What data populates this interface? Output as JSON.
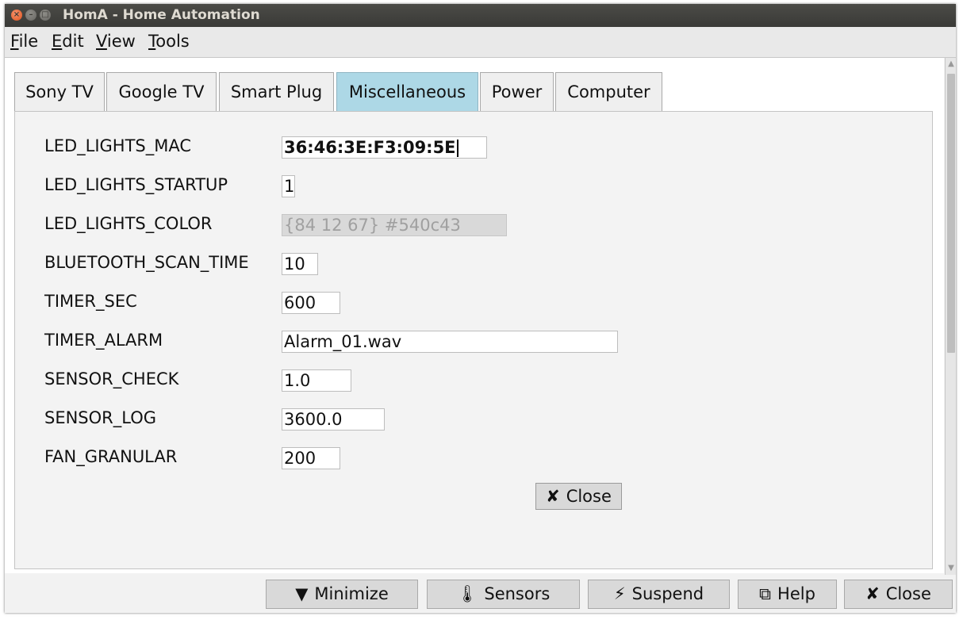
{
  "window": {
    "title": "HomA - Home Automation"
  },
  "menubar": {
    "items": [
      {
        "mnemonic": "F",
        "rest": "ile"
      },
      {
        "mnemonic": "E",
        "rest": "dit"
      },
      {
        "mnemonic": "V",
        "rest": "iew"
      },
      {
        "mnemonic": "T",
        "rest": "ools"
      }
    ]
  },
  "tabs": [
    {
      "label": "Sony TV"
    },
    {
      "label": "Google TV"
    },
    {
      "label": "Smart Plug"
    },
    {
      "label": "Miscellaneous",
      "active": true
    },
    {
      "label": "Power"
    },
    {
      "label": "Computer"
    }
  ],
  "fields": [
    {
      "label": "LED_LIGHTS_MAC",
      "value": "36:46:3E:F3:09:5E"
    },
    {
      "label": "LED_LIGHTS_STARTUP",
      "value": "1"
    },
    {
      "label": "LED_LIGHTS_COLOR",
      "value": "{84 12 67} #540c43"
    },
    {
      "label": "BLUETOOTH_SCAN_TIME",
      "value": "10"
    },
    {
      "label": "TIMER_SEC",
      "value": "600"
    },
    {
      "label": "TIMER_ALARM",
      "value": "Alarm_01.wav"
    },
    {
      "label": "SENSOR_CHECK",
      "value": "1.0"
    },
    {
      "label": "SENSOR_LOG",
      "value": "3600.0"
    },
    {
      "label": "FAN_GRANULAR",
      "value": "200"
    }
  ],
  "panel": {
    "close_glyph": "✘",
    "close_label": "Close"
  },
  "bottom_buttons": {
    "minimize": {
      "glyph": "▼",
      "label": "Minimize"
    },
    "sensors": {
      "glyph": "🌡",
      "label": "Sensors"
    },
    "suspend": {
      "glyph": "⚡",
      "label": "Suspend"
    },
    "help": {
      "glyph": "⧉",
      "label": "Help"
    },
    "close": {
      "glyph": "✘",
      "label": "Close"
    }
  },
  "colors": {
    "active_tab": "#add8e6",
    "titlebar": "#3c3b37",
    "close_button": "#e95420"
  }
}
